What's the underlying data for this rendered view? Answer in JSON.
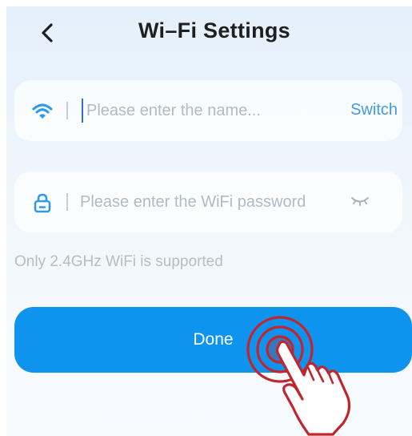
{
  "header": {
    "title": "Wi–Fi Settings",
    "back_icon": "chevron-left-icon"
  },
  "ssid_field": {
    "icon": "wifi-icon",
    "placeholder": "Please enter the name...",
    "value": "",
    "switch_label": "Switch"
  },
  "password_field": {
    "icon": "lock-icon",
    "placeholder": "Please enter the WiFi password",
    "value": "",
    "visibility_icon": "eye-closed-icon"
  },
  "hint": "Only 2.4GHz WiFi is supported",
  "done_button": {
    "label": "Done"
  },
  "tap_indicator": {
    "icon": "tap-hand-icon",
    "color": "#c0262d"
  },
  "colors": {
    "accent": "#0e93ef",
    "link": "#3f9bea",
    "background_top": "#e4f0fb"
  }
}
